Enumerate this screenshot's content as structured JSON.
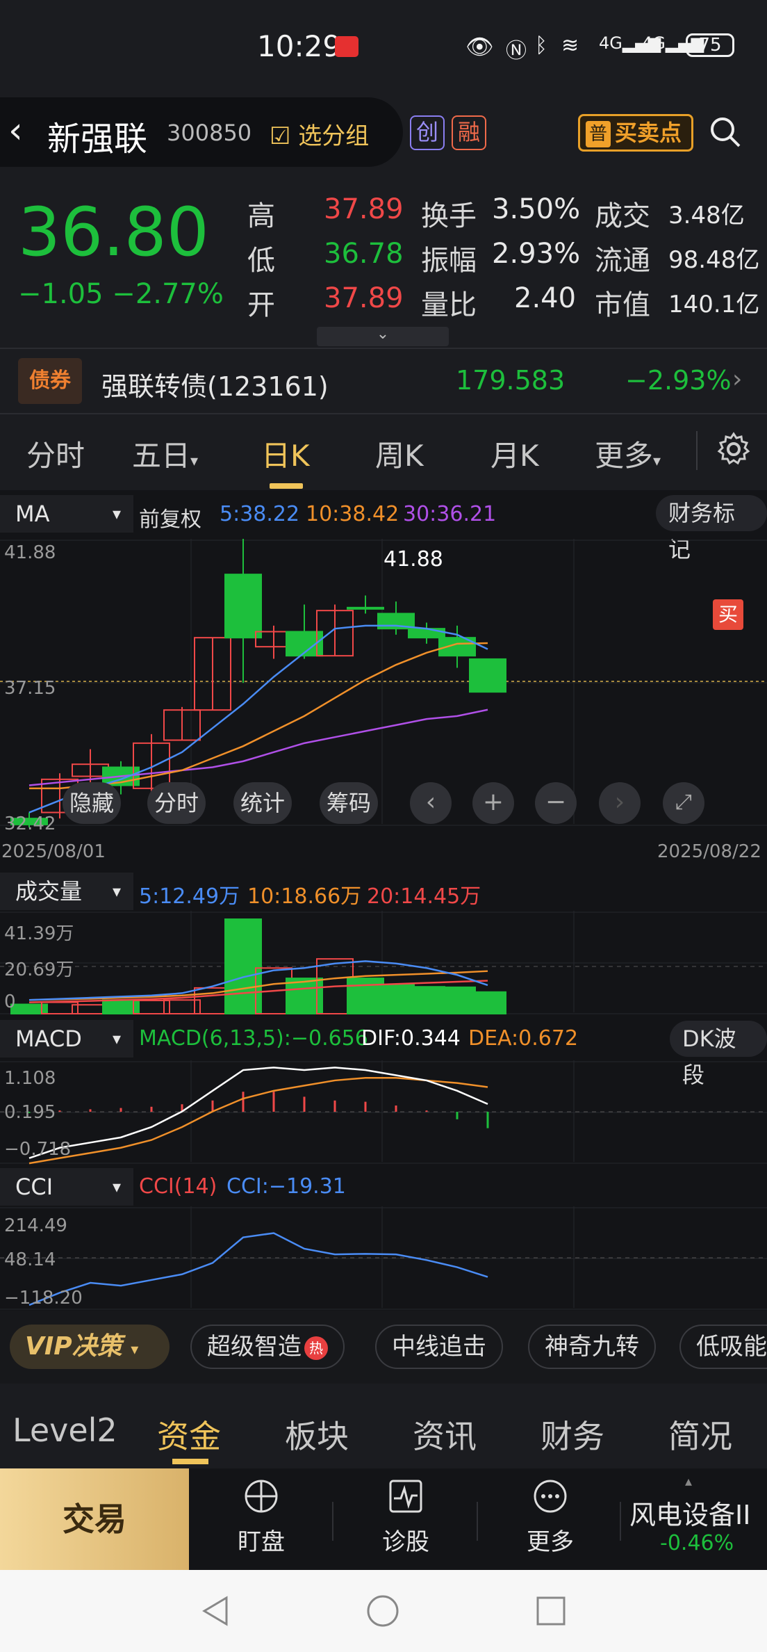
{
  "status": {
    "time": "10:29",
    "battery": "75",
    "net1": "4G",
    "net2": "4G"
  },
  "stock": {
    "name": "新强联",
    "code": "300850",
    "group_label": "选分组",
    "tag1": "创",
    "tag2": "融",
    "buy_sell_label": "买卖点",
    "buy_sell_badge": "普"
  },
  "quote": {
    "price": "36.80",
    "change": "−1.05",
    "change_pct": "−2.77%",
    "high_label": "高",
    "high": "37.89",
    "low_label": "低",
    "low": "36.78",
    "open_label": "开",
    "open": "37.89",
    "turnover_label": "换手",
    "turnover": "3.50%",
    "amplitude_label": "振幅",
    "amplitude": "2.93%",
    "vol_ratio_label": "量比",
    "vol_ratio": "2.40",
    "amount_label": "成交",
    "amount": "3.48亿",
    "float_label": "流通",
    "float": "98.48亿",
    "mcap_label": "市值",
    "mcap": "140.1亿"
  },
  "bond": {
    "badge": "债券",
    "name": "强联转债(123161)",
    "price": "179.583",
    "pct": "−2.93%"
  },
  "period_tabs": [
    "分时",
    "五日",
    "日K",
    "周K",
    "月K",
    "更多"
  ],
  "active_period": 2,
  "ma": {
    "selector": "MA",
    "adjust": "前复权",
    "ma5": "5:38.22",
    "ma10": "10:38.42",
    "ma30": "30:36.21",
    "right_btn": "财务标记"
  },
  "kline_axis": {
    "top": "41.88",
    "mid": "37.15",
    "bottom": "32.42",
    "start_date": "2025/08/01",
    "end_date": "2025/08/22",
    "peak_label": "41.88",
    "buy_marker": "买"
  },
  "chart_controls": {
    "hide": "隐藏",
    "intraday": "分时",
    "stats": "统计",
    "chips": "筹码"
  },
  "volume": {
    "selector": "成交量",
    "ma5": "5:12.49万",
    "ma10": "10:18.66万",
    "ma20": "20:14.45万",
    "axis_top": "41.39万",
    "axis_mid": "20.69万",
    "axis_bottom": "0"
  },
  "macd": {
    "selector": "MACD",
    "macd": "MACD(6,13,5):−0.656",
    "dif": "DIF:0.344",
    "dea": "DEA:0.672",
    "right_btn": "DK波段",
    "axis_top": "1.108",
    "axis_mid": "0.195",
    "axis_bottom": "−0.718"
  },
  "cci": {
    "selector": "CCI",
    "param": "CCI(14)",
    "value": "CCI:−19.31",
    "axis_top": "214.49",
    "axis_mid": "48.14",
    "axis_bottom": "−118.20"
  },
  "chart_data": {
    "type": "candlestick",
    "candles": [
      {
        "o": 32.6,
        "h": 32.8,
        "l": 32.3,
        "c": 32.4,
        "up": false
      },
      {
        "o": 32.8,
        "h": 34.1,
        "l": 32.6,
        "c": 33.9,
        "up": true
      },
      {
        "o": 34.0,
        "h": 34.9,
        "l": 33.7,
        "c": 34.4,
        "up": true
      },
      {
        "o": 34.3,
        "h": 34.5,
        "l": 33.4,
        "c": 33.7,
        "up": false
      },
      {
        "o": 33.6,
        "h": 35.4,
        "l": 33.4,
        "c": 35.1,
        "up": true
      },
      {
        "o": 35.2,
        "h": 36.3,
        "l": 35.2,
        "c": 36.2,
        "up": true
      },
      {
        "o": 36.2,
        "h": 38.6,
        "l": 36.2,
        "c": 38.6,
        "up": true
      },
      {
        "o": 40.7,
        "h": 41.88,
        "l": 37.1,
        "c": 38.6,
        "up": false
      },
      {
        "o": 38.3,
        "h": 39.0,
        "l": 37.9,
        "c": 38.8,
        "up": true
      },
      {
        "o": 38.8,
        "h": 39.7,
        "l": 37.9,
        "c": 38.0,
        "up": false
      },
      {
        "o": 38.0,
        "h": 39.7,
        "l": 38.0,
        "c": 39.5,
        "up": true
      },
      {
        "o": 39.6,
        "h": 40.0,
        "l": 39.4,
        "c": 39.6,
        "up": false
      },
      {
        "o": 39.4,
        "h": 39.8,
        "l": 38.7,
        "c": 38.9,
        "up": false
      },
      {
        "o": 38.9,
        "h": 39.1,
        "l": 38.4,
        "c": 38.6,
        "up": false
      },
      {
        "o": 38.6,
        "h": 39.0,
        "l": 37.6,
        "c": 38.0,
        "up": false
      },
      {
        "o": 37.89,
        "h": 37.89,
        "l": 36.78,
        "c": 36.8,
        "up": false
      }
    ],
    "ma5": [
      32.8,
      33.2,
      33.6,
      33.9,
      34.3,
      34.8,
      35.6,
      36.4,
      37.3,
      38.1,
      38.9,
      39.0,
      39.0,
      38.9,
      38.7,
      38.22
    ],
    "ma10": [
      33.6,
      33.6,
      33.7,
      33.8,
      34.0,
      34.2,
      34.6,
      35.0,
      35.5,
      36.0,
      36.6,
      37.2,
      37.7,
      38.1,
      38.4,
      38.42
    ],
    "ma30": [
      33.7,
      33.8,
      33.9,
      34.0,
      34.1,
      34.2,
      34.3,
      34.5,
      34.8,
      35.1,
      35.3,
      35.5,
      35.7,
      35.9,
      36.0,
      36.21
    ],
    "volume": [
      4.1,
      5.0,
      3.9,
      6.0,
      5.8,
      6.0,
      11.3,
      41.39,
      20.0,
      15.5,
      24.0,
      15.5,
      12.7,
      11.8,
      11.6,
      9.5
    ],
    "vol_up": [
      false,
      true,
      true,
      false,
      true,
      true,
      true,
      false,
      true,
      false,
      true,
      false,
      false,
      false,
      false,
      false
    ],
    "vol_ma5": [
      6,
      6.5,
      7,
      7.5,
      8,
      9,
      12,
      16,
      19,
      20,
      22,
      23,
      22,
      20,
      17,
      12.49
    ],
    "vol_ma10": [
      6,
      6.3,
      6.6,
      7,
      7.4,
      8,
      9,
      11,
      13,
      14,
      15.5,
      16.5,
      17,
      17.5,
      18,
      18.66
    ],
    "vol_ma20": [
      5,
      5.3,
      5.6,
      6,
      6.4,
      7,
      8,
      9,
      10,
      11,
      12,
      12.5,
      13,
      13.5,
      14,
      14.45
    ],
    "macd_hist": [
      -0.05,
      0.05,
      0.1,
      0.15,
      0.2,
      0.3,
      0.45,
      0.8,
      0.8,
      0.6,
      0.45,
      0.4,
      0.25,
      0.05,
      -0.3,
      -0.656
    ],
    "dif": [
      -0.7,
      -0.5,
      -0.4,
      -0.3,
      -0.1,
      0.2,
      0.6,
      1.0,
      1.05,
      1.0,
      1.05,
      1.0,
      0.9,
      0.8,
      0.6,
      0.344
    ],
    "dea": [
      -0.8,
      -0.7,
      -0.6,
      -0.5,
      -0.35,
      -0.1,
      0.2,
      0.45,
      0.6,
      0.7,
      0.8,
      0.85,
      0.85,
      0.8,
      0.75,
      0.672
    ],
    "cci": [
      -118,
      -75,
      -40,
      -50,
      -30,
      -10,
      30,
      120,
      135,
      80,
      60,
      62,
      60,
      40,
      15,
      -19.31
    ]
  },
  "vip": {
    "label": "VIP决策",
    "pills": [
      "超级智造",
      "中线追击",
      "神奇九转",
      "低吸能"
    ],
    "hot": "热"
  },
  "bottom_tabs": [
    "Level2",
    "资金",
    "板块",
    "资讯",
    "财务",
    "简况"
  ],
  "active_bottom_tab": 1,
  "actions": {
    "trade": "交易",
    "watch": "盯盘",
    "diagnose": "诊股",
    "more": "更多",
    "sector": "风电设备II",
    "sector_pct": "-0.46%"
  },
  "colors": {
    "up": "#f04848",
    "down": "#1dbf3c",
    "ma5": "#4a8cf5",
    "ma10": "#f0902a",
    "ma30": "#b050e8",
    "accent": "#f0c45a"
  }
}
